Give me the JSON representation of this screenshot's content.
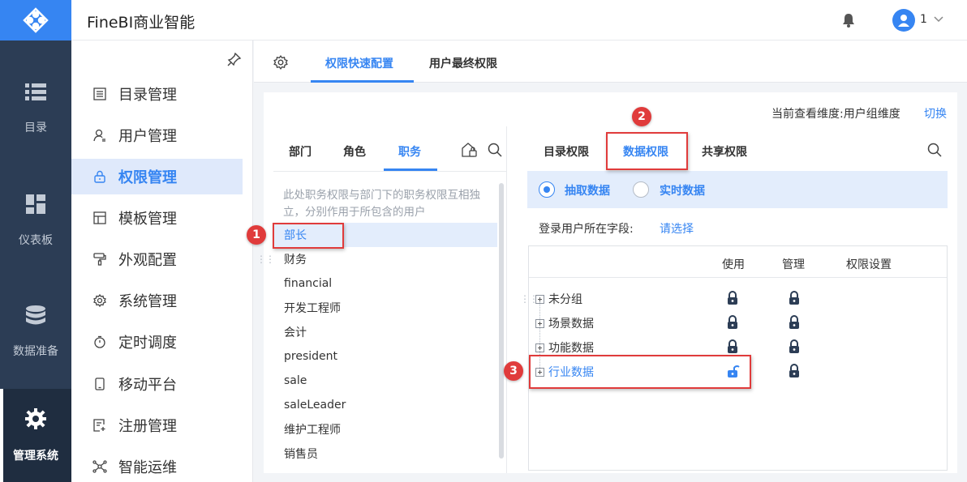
{
  "app": {
    "title": "FineBI商业智能",
    "user": "1"
  },
  "rail": [
    {
      "label": "目录",
      "icon": "list-icon"
    },
    {
      "label": "仪表板",
      "icon": "dashboard-icon"
    },
    {
      "label": "数据准备",
      "icon": "database-icon"
    },
    {
      "label": "管理系统",
      "icon": "gear-icon",
      "active": true
    }
  ],
  "menu": [
    {
      "label": "目录管理",
      "icon": "catalog-icon"
    },
    {
      "label": "用户管理",
      "icon": "user-icon"
    },
    {
      "label": "权限管理",
      "icon": "lock-icon",
      "active": true
    },
    {
      "label": "模板管理",
      "icon": "template-icon"
    },
    {
      "label": "外观配置",
      "icon": "paint-roller-icon"
    },
    {
      "label": "系统管理",
      "icon": "gear-icon"
    },
    {
      "label": "定时调度",
      "icon": "timer-icon"
    },
    {
      "label": "移动平台",
      "icon": "mobile-icon"
    },
    {
      "label": "注册管理",
      "icon": "register-icon"
    },
    {
      "label": "智能运维",
      "icon": "network-icon"
    }
  ],
  "main_tabs": [
    "权限快速配置",
    "用户最终权限"
  ],
  "dimension": {
    "label": "当前查看维度:用户组维度",
    "switch": "切换"
  },
  "left_pane": {
    "tabs": [
      "部门",
      "角色",
      "职务"
    ],
    "active_tab": "职务",
    "note": "此处职务权限与部门下的职务权限互相独立，分别作用于所包含的用户",
    "items": [
      "部长",
      "财务",
      "financial",
      "开发工程师",
      "会计",
      "president",
      "sale",
      "saleLeader",
      "维护工程师",
      "销售员"
    ],
    "selected": "部长"
  },
  "right_pane": {
    "tabs": [
      "目录权限",
      "数据权限",
      "共享权限"
    ],
    "active_tab": "数据权限",
    "modes": [
      "抽取数据",
      "实时数据"
    ],
    "selected_mode": "抽取数据",
    "field_label": "登录用户所在字段:",
    "field_value": "请选择",
    "columns": [
      "使用",
      "管理",
      "权限设置"
    ],
    "rows": [
      {
        "name": "未分组",
        "use": "locked",
        "manage": "locked"
      },
      {
        "name": "场景数据",
        "use": "locked",
        "manage": "locked"
      },
      {
        "name": "功能数据",
        "use": "locked",
        "manage": "locked"
      },
      {
        "name": "行业数据",
        "use": "unlocked",
        "manage": "locked"
      }
    ]
  },
  "annotations": [
    "1",
    "2",
    "3"
  ],
  "colors": {
    "accent": "#3685f2",
    "rail": "#2c3d55",
    "highlight": "#e03b3b"
  }
}
